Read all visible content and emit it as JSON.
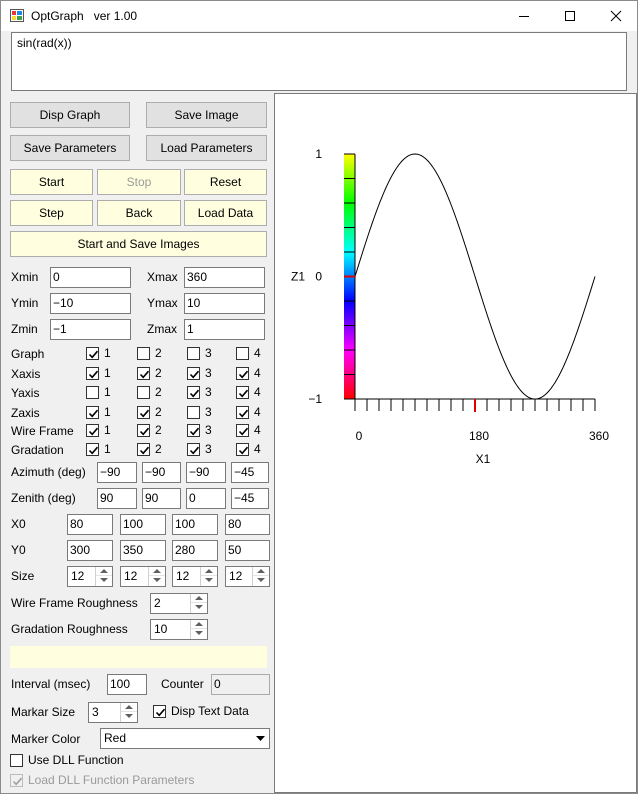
{
  "window": {
    "title": "OptGraph   ver 1.00"
  },
  "formula": "sin(rad(x))",
  "buttons": {
    "disp_graph": "Disp Graph",
    "save_image": "Save Image",
    "save_params": "Save Parameters",
    "load_params": "Load Parameters",
    "start": "Start",
    "stop": "Stop",
    "reset": "Reset",
    "step": "Step",
    "back": "Back",
    "load_data": "Load Data",
    "start_save": "Start and Save Images"
  },
  "ranges": {
    "xmin_label": "Xmin",
    "xmin": "0",
    "xmax_label": "Xmax",
    "xmax": "360",
    "ymin_label": "Ymin",
    "ymin": "−10",
    "ymax_label": "Ymax",
    "ymax": "10",
    "zmin_label": "Zmin",
    "zmin": "−1",
    "zmax_label": "Zmax",
    "zmax": "1"
  },
  "grid": {
    "rows": [
      {
        "label": "Graph",
        "checks": [
          true,
          false,
          false,
          false
        ]
      },
      {
        "label": "Xaxis",
        "checks": [
          true,
          true,
          true,
          true
        ]
      },
      {
        "label": "Yaxis",
        "checks": [
          false,
          false,
          true,
          true
        ]
      },
      {
        "label": "Zaxis",
        "checks": [
          true,
          true,
          false,
          true
        ]
      },
      {
        "label": "Wire Frame",
        "checks": [
          true,
          true,
          true,
          true
        ]
      },
      {
        "label": "Gradation",
        "checks": [
          true,
          true,
          true,
          true
        ]
      }
    ],
    "col_labels": [
      "1",
      "2",
      "3",
      "4"
    ]
  },
  "angles": {
    "azimuth_label": "Azimuth (deg)",
    "azimuth": [
      "−90",
      "−90",
      "−90",
      "−45"
    ],
    "zenith_label": "Zenith (deg)",
    "zenith": [
      "90",
      "90",
      "0",
      "−45"
    ]
  },
  "positions": {
    "x0_label": "X0",
    "x0": [
      "80",
      "100",
      "100",
      "80"
    ],
    "y0_label": "Y0",
    "y0": [
      "300",
      "350",
      "280",
      "50"
    ],
    "size_label": "Size",
    "size": [
      "12",
      "12",
      "12",
      "12"
    ]
  },
  "roughness": {
    "wire_label": "Wire Frame Roughness",
    "wire": "2",
    "grad_label": "Gradation Roughness",
    "grad": "10"
  },
  "interval": {
    "label": "Interval (msec)",
    "value": "100",
    "counter_label": "Counter",
    "counter": "0"
  },
  "marker": {
    "size_label": "Markar Size",
    "size": "3",
    "disp_text_label": "Disp Text Data",
    "disp_text": true,
    "color_label": "Marker Color",
    "color": "Red"
  },
  "dll": {
    "use_label": "Use DLL Function",
    "use": false,
    "load_label": "Load DLL Function Parameters",
    "load": true
  },
  "chart_data": {
    "type": "line",
    "function": "sin(rad(x))",
    "xlabel": "X1",
    "ylabel": "Z1",
    "xlim": [
      0,
      360
    ],
    "ylim": [
      -1,
      1
    ],
    "x_ticks": [
      "0",
      "180",
      "360"
    ],
    "y_ticks": [
      "1",
      "0",
      "−1"
    ],
    "marker_x": 180,
    "marker_y": 0,
    "colors": {
      "line": "#000000",
      "marker": "#e00000"
    },
    "gradation": [
      "#ff0000",
      "#ff00ff",
      "#0000ff",
      "#00ffff",
      "#00ff00",
      "#ffff00"
    ]
  }
}
